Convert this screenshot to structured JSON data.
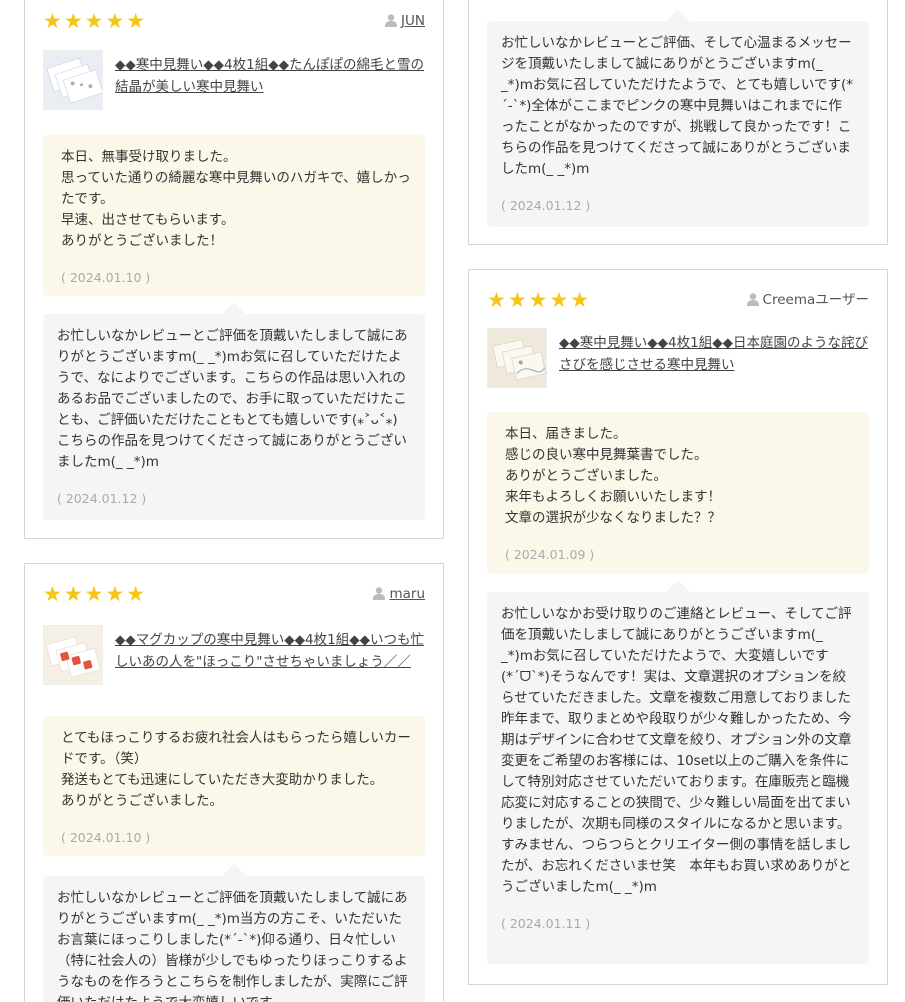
{
  "reviews": [
    {
      "rating": 5,
      "stars": "★★★★★",
      "user": "JUN",
      "product_title": "◆◆寒中見舞い◆◆4枚1組◆◆たんぽぽの綿毛と雪の結晶が美しい寒中見舞い",
      "review_text": "本日、無事受け取りました。\n思っていた通りの綺麗な寒中見舞いのハガキで、嬉しかったです。\n早速、出させてもらいます。\nありがとうございました！",
      "review_date": "( 2024.01.10 )",
      "reply_text": "お忙しいなかレビューとご評価を頂戴いたしまして誠にありがとうございますm(_ _*)mお気に召していただけたようで、なによりでございます。こちらの作品は思い入れのあるお品でございましたので、お手に取っていただけたことも、ご評価いただけたこともとても嬉しいです(⁎˃ᴗ˂⁎)こちらの作品を見つけてくださって誠にありがとうございましたm(_ _*)m",
      "reply_date": "( 2024.01.12 )"
    },
    {
      "rating": 5,
      "stars": "★★★★★",
      "user": "maru",
      "product_title": "◆◆マグカップの寒中見舞い◆◆4枚1組◆◆いつも忙しいあの人を\"ほっこり\"させちゃいましょう／／",
      "review_text": "とてもほっこりするお疲れ社会人はもらったら嬉しいカードです。（笑）\n発送もとても迅速にしていただき大変助かりました。\nありがとうございました。",
      "review_date": "( 2024.01.10 )",
      "reply_text": "お忙しいなかレビューとご評価を頂戴いたしまして誠にありがとうございますm(_ _*)m当方の方こそ、いただいたお言葉にほっこりしました(*´-`*)仰る通り、日々忙しい（特に社会人の）皆様が少しでもゆったりほっこりするようなものを作ろうとこちらを制作しましたが、実際にご評価いただけたようで大変嬉しいです",
      "reply_date": ""
    },
    {
      "reply_text": "お忙しいなかレビューとご評価、そして心温まるメッセージを頂戴いたしまして誠にありがとうございますm(_ _*)mお気に召していただけたようで、とても嬉しいです(*´-`*)全体がここまでピンクの寒中見舞いはこれまでに作ったことがなかったのですが、挑戦して良かったです！こちらの作品を見つけてくださって誠にありがとうございましたm(_ _*)m",
      "reply_date": "( 2024.01.12 )"
    },
    {
      "rating": 5,
      "stars": "★★★★★",
      "user": "Creemaユーザー",
      "product_title": "◆◆寒中見舞い◆◆4枚1組◆◆日本庭園のような詫びさびを感じさせる寒中見舞い",
      "review_text": "本日、届きました。\n感じの良い寒中見舞葉書でした。\nありがとうございました。\n来年もよろしくお願いいたします！\n文章の選択が少なくなりました？？",
      "review_date": "( 2024.01.09 )",
      "reply_text": "お忙しいなかお受け取りのご連絡とレビュー、そしてご評価を頂戴いたしまして誠にありがとうございますm(_ _*)mお気に召していただけたようで、大変嬉しいです(*ˊᗜˋ*)そうなんです！実は、文章選択のオプションを絞らせていただきました。文章を複数ご用意しておりました昨年まで、取りまとめや段取りが少々難しかったため、今期はデザインに合わせて文章を絞り、オプション外の文章変更をご希望のお客様には、10set以上のご購入を条件にして特別対応させていただいております。在庫販売と臨機応変に対応することの狭間で、少々難しい局面を出てまいりましたが、次期も同様のスタイルになるかと思います。すみません、つらつらとクリエイター側の事情を話しましたが、お忘れくださいませ笑　本年もお買い求めありがとうございましたm(_ _*)m",
      "reply_date": "( 2024.01.11 )"
    }
  ],
  "icons": {
    "person": "person-icon",
    "star": "star-icon"
  },
  "colors": {
    "star": "#f5c518",
    "review_bg": "#fbf8ea",
    "reply_bg": "#f5f5f5",
    "border": "#d6d6d6"
  }
}
